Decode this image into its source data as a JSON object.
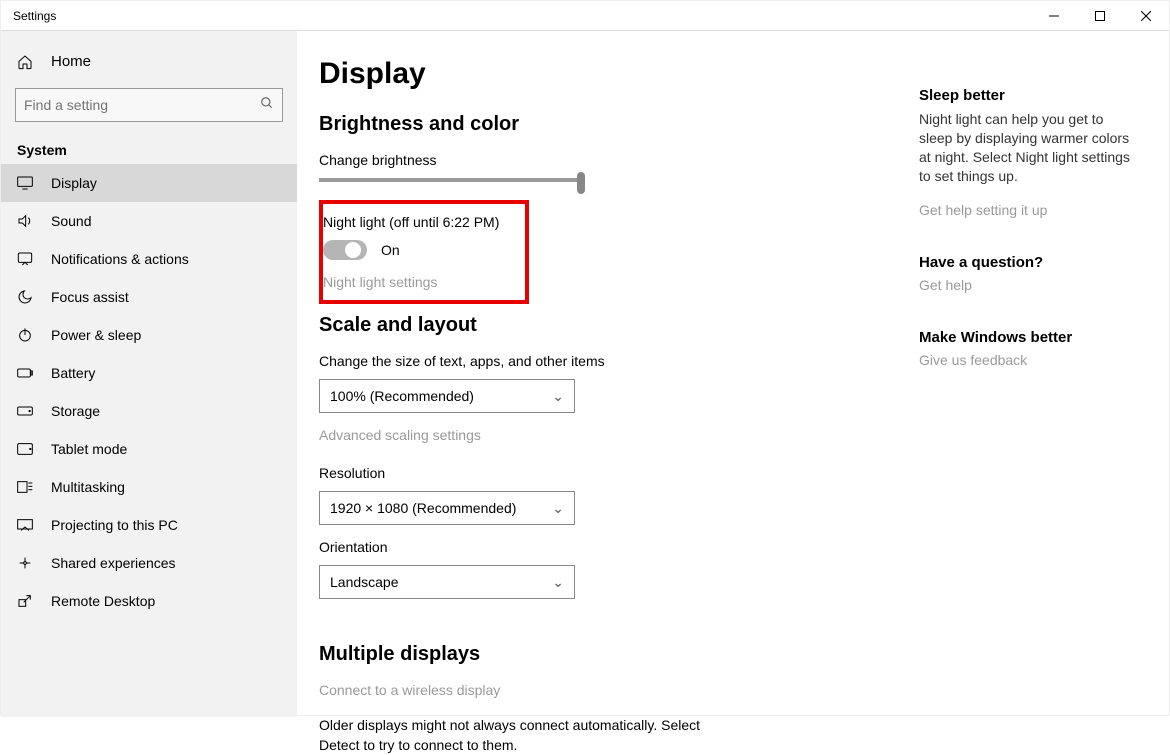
{
  "title": "Settings",
  "sidebar": {
    "home": "Home",
    "search_placeholder": "Find a setting",
    "group": "System",
    "items": [
      {
        "label": "Display"
      },
      {
        "label": "Sound"
      },
      {
        "label": "Notifications & actions"
      },
      {
        "label": "Focus assist"
      },
      {
        "label": "Power & sleep"
      },
      {
        "label": "Battery"
      },
      {
        "label": "Storage"
      },
      {
        "label": "Tablet mode"
      },
      {
        "label": "Multitasking"
      },
      {
        "label": "Projecting to this PC"
      },
      {
        "label": "Shared experiences"
      },
      {
        "label": "Remote Desktop"
      }
    ]
  },
  "page": {
    "h1": "Display",
    "sec_brightness": "Brightness and color",
    "brightness_label": "Change brightness",
    "nightlight_label": "Night light (off until 6:22 PM)",
    "nightlight_state": "On",
    "nightlight_link": "Night light settings",
    "sec_scale": "Scale and layout",
    "scale_label": "Change the size of text, apps, and other items",
    "scale_value": "100% (Recommended)",
    "advanced_scaling": "Advanced scaling settings",
    "resolution_label": "Resolution",
    "resolution_value": "1920 × 1080 (Recommended)",
    "orientation_label": "Orientation",
    "orientation_value": "Landscape",
    "sec_multi": "Multiple displays",
    "wireless_link": "Connect to a wireless display",
    "multi_note": "Older displays might not always connect automatically. Select Detect to try to connect to them."
  },
  "right": {
    "h1": "Sleep better",
    "p1": "Night light can help you get to sleep by displaying warmer colors at night. Select Night light settings to set things up.",
    "l1": "Get help setting it up",
    "h2": "Have a question?",
    "l2": "Get help",
    "h3": "Make Windows better",
    "l3": "Give us feedback"
  }
}
